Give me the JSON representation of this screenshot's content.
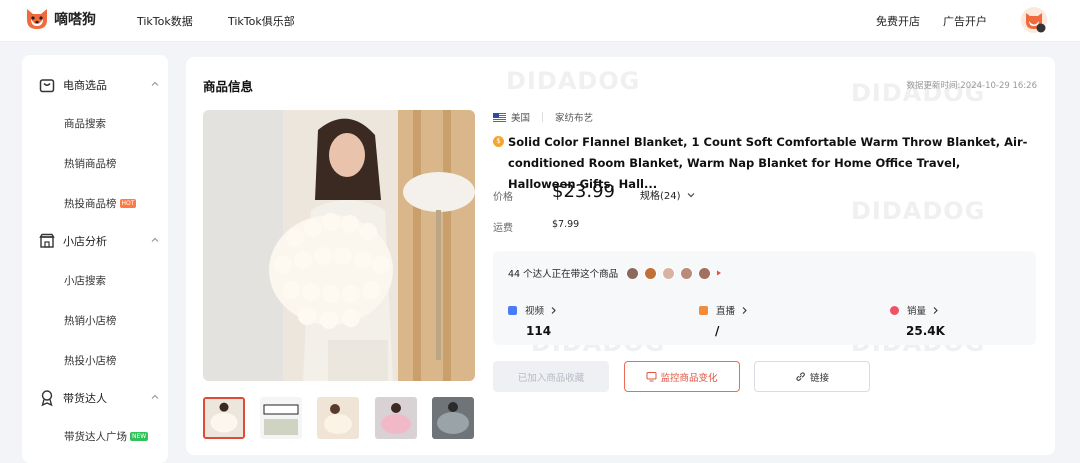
{
  "app": {
    "name": "嘀嗒狗"
  },
  "topnav": {
    "items": [
      "TikTok数据",
      "TikTok俱乐部"
    ],
    "right": [
      "免费开店",
      "广告开户"
    ]
  },
  "sidebar": {
    "sections": [
      {
        "label": "电商选品",
        "icon": "shopping-bag-icon",
        "items": [
          {
            "label": "商品搜索"
          },
          {
            "label": "热销商品榜"
          },
          {
            "label": "热投商品榜",
            "badge": "HOT"
          }
        ]
      },
      {
        "label": "小店分析",
        "icon": "store-icon",
        "items": [
          {
            "label": "小店搜索"
          },
          {
            "label": "热销小店榜"
          },
          {
            "label": "热投小店榜"
          }
        ]
      },
      {
        "label": "带货达人",
        "icon": "award-icon",
        "items": [
          {
            "label": "带货达人广场",
            "badge": "NEW"
          }
        ]
      }
    ]
  },
  "product": {
    "section_title": "商品信息",
    "update_time": "数据更新时间:2024-10-29 16:26",
    "country": "美国",
    "category": "家纺布艺",
    "title": "Solid Color Flannel Blanket, 1 Count Soft Comfortable Warm Throw Blanket, Air-conditioned Room Blanket, Warm Nap Blanket for Home Office Travel, Halloween Gifts, Hall...",
    "price_label": "价格",
    "price": "$23.99",
    "spec": "规格(24)",
    "shipping_label": "运费",
    "shipping": "$7.99",
    "watermark": "DIDADOG"
  },
  "stats": {
    "kol_text": "44 个达人正在带这个商品",
    "items": [
      {
        "label": "视频",
        "value": "114",
        "color": "#4a7cf7"
      },
      {
        "label": "直播",
        "value": "/",
        "color": "#f28b3c"
      },
      {
        "label": "销量",
        "value": "25.4K",
        "color": "#f05264"
      }
    ]
  },
  "actions": {
    "collected": "已加入商品收藏",
    "monitor": "监控商品变化",
    "link": "链接"
  },
  "colors": {
    "accent": "#e0533f",
    "hot_badge": "#ff7a45",
    "new_badge": "#32c25b"
  }
}
